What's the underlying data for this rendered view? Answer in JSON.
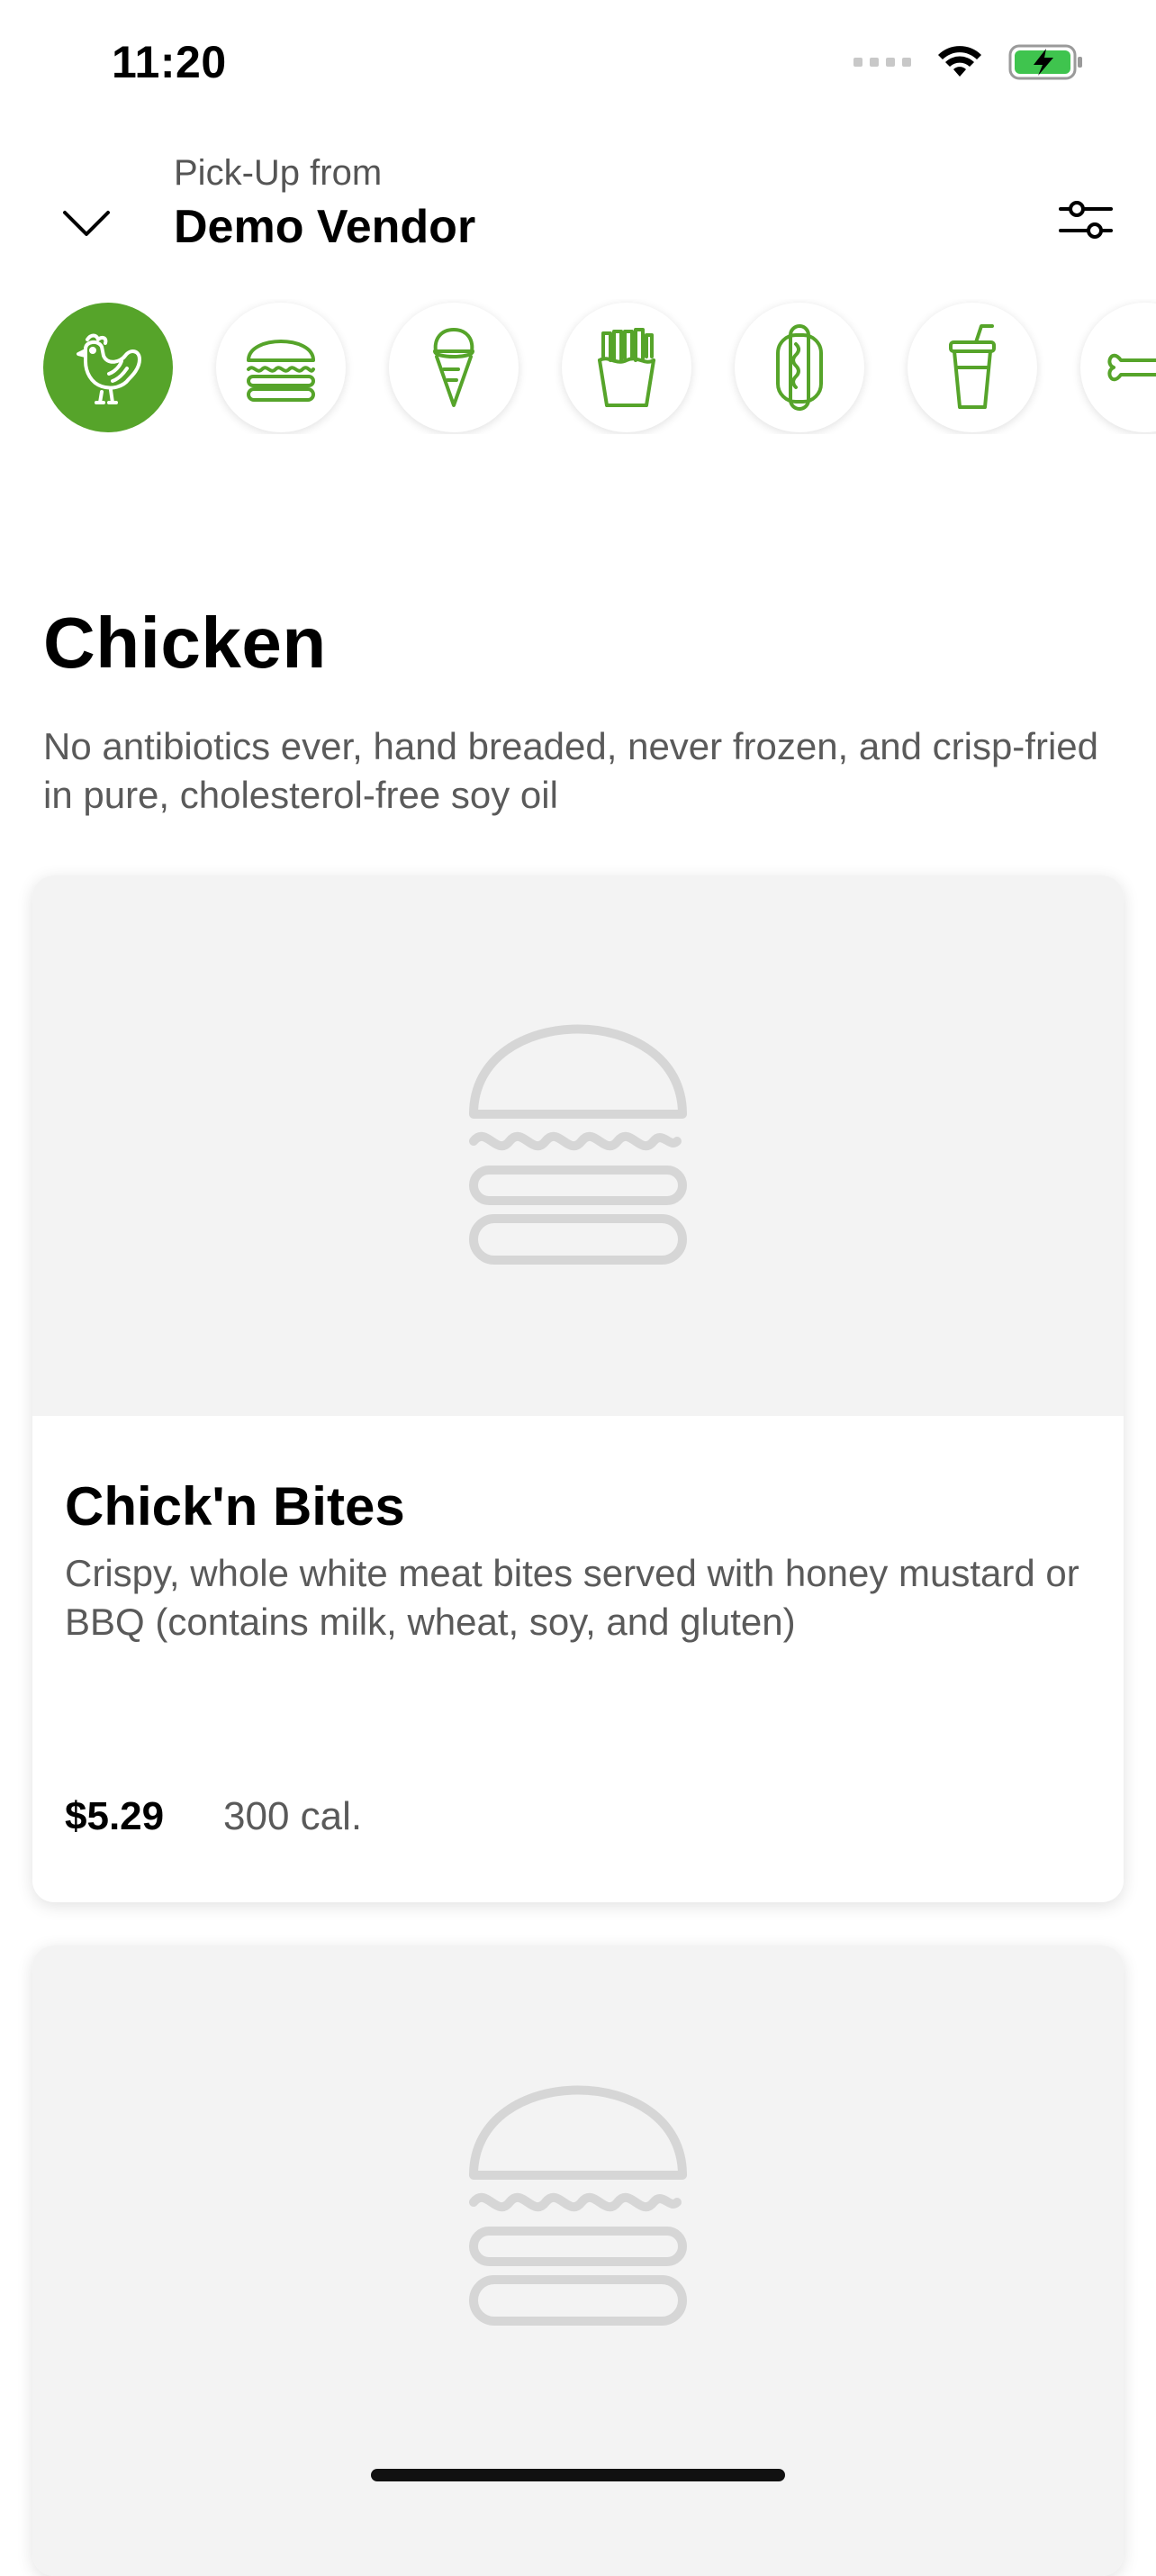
{
  "status_bar": {
    "time": "11:20"
  },
  "header": {
    "pickup_label": "Pick-Up from",
    "vendor_name": "Demo Vendor"
  },
  "categories": [
    {
      "icon": "chicken-icon",
      "active": true
    },
    {
      "icon": "burger-icon",
      "active": false
    },
    {
      "icon": "ice-cream-icon",
      "active": false
    },
    {
      "icon": "fries-icon",
      "active": false
    },
    {
      "icon": "hot-dog-icon",
      "active": false
    },
    {
      "icon": "drink-icon",
      "active": false
    },
    {
      "icon": "dog-bone-icon",
      "active": false
    }
  ],
  "section": {
    "title": "Chicken",
    "description": "No antibiotics ever, hand breaded, never frozen, and crisp-fried in pure, cholesterol-free soy oil"
  },
  "items": [
    {
      "name": "Chick'n Bites",
      "description": "Crispy, whole white meat bites served with honey mustard or BBQ (contains milk, wheat, soy, and gluten)",
      "price": "$5.29",
      "calories": "300 cal."
    }
  ],
  "colors": {
    "accent": "#56a42a",
    "placeholder_bg": "#f3f3f3",
    "placeholder_icon": "#d6d6d6"
  }
}
